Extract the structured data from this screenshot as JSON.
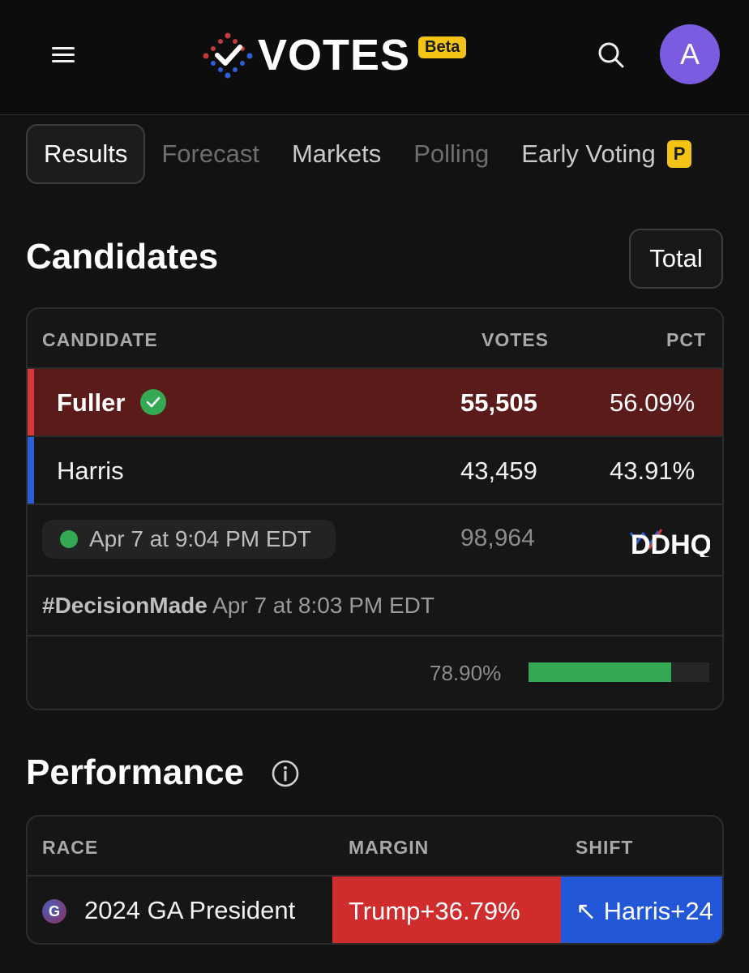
{
  "header": {
    "logo_text": "VOTES",
    "beta_label": "Beta",
    "avatar_letter": "A"
  },
  "tabs": [
    {
      "label": "Results",
      "state": "active"
    },
    {
      "label": "Forecast",
      "state": "disabled"
    },
    {
      "label": "Markets",
      "state": "normal"
    },
    {
      "label": "Polling",
      "state": "disabled"
    },
    {
      "label": "Early Voting",
      "state": "normal",
      "badge": "P"
    }
  ],
  "candidates": {
    "title": "Candidates",
    "total_button": "Total",
    "columns": {
      "candidate": "CANDIDATE",
      "votes": "VOTES",
      "pct": "PCT"
    },
    "rows": [
      {
        "name": "Fuller",
        "votes": "55,505",
        "pct": "56.09%",
        "party_color": "#d33a3a",
        "winner": true
      },
      {
        "name": "Harris",
        "votes": "43,459",
        "pct": "43.91%",
        "party_color": "#2b5fd8",
        "winner": false
      }
    ],
    "status_time": "Apr 7 at 9:04 PM EDT",
    "total_votes": "98,964",
    "source": "DDHQ",
    "decision_tag": "#DecisionMade",
    "decision_time": "Apr 7 at 8:03 PM EDT",
    "reporting_text": "78.90%",
    "reporting_fraction": 0.789
  },
  "performance": {
    "title": "Performance",
    "columns": {
      "race": "RACE",
      "margin": "MARGIN",
      "shift": "SHIFT"
    },
    "rows": [
      {
        "badge": "G",
        "race": "2024 GA President",
        "margin": "Trump+36.79%",
        "shift": "↖ Harris+24"
      }
    ]
  },
  "colors": {
    "accent_yellow": "#f3c316",
    "winner_row": "#5b1b1b",
    "rep_red": "#cf2d2d",
    "dem_blue": "#2258d8",
    "progress_green": "#34a853",
    "avatar_purple": "#7b5ce0"
  }
}
